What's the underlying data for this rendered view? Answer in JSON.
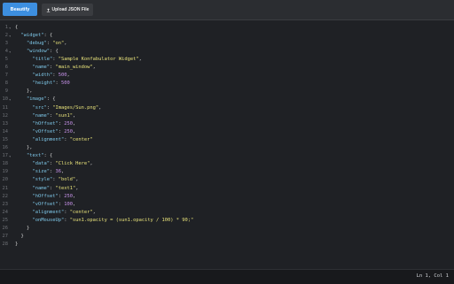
{
  "toolbar": {
    "beautify_label": "Beautify",
    "upload_label": "Upload JSON File",
    "upload_icon": "upload-icon"
  },
  "status": {
    "cursor": "Ln 1, Col 1"
  },
  "colors": {
    "accent": "#3d8fe0",
    "key": "#7ec7e8",
    "string": "#e8e27a",
    "number": "#c792ea",
    "background": "#1f2125"
  },
  "editor": {
    "lines": [
      {
        "n": "1",
        "fold": true,
        "t": [
          [
            "p",
            "{"
          ]
        ]
      },
      {
        "n": "2",
        "fold": true,
        "t": [
          [
            "p",
            "  "
          ],
          [
            "k",
            "\"widget\""
          ],
          [
            "p",
            ": {"
          ]
        ]
      },
      {
        "n": "3",
        "fold": false,
        "t": [
          [
            "p",
            "    "
          ],
          [
            "k",
            "\"debug\""
          ],
          [
            "p",
            ": "
          ],
          [
            "s",
            "\"on\""
          ],
          [
            "p",
            ","
          ]
        ]
      },
      {
        "n": "4",
        "fold": true,
        "t": [
          [
            "p",
            "    "
          ],
          [
            "k",
            "\"window\""
          ],
          [
            "p",
            ": {"
          ]
        ]
      },
      {
        "n": "5",
        "fold": false,
        "t": [
          [
            "p",
            "      "
          ],
          [
            "k",
            "\"title\""
          ],
          [
            "p",
            ": "
          ],
          [
            "s",
            "\"Sample Konfabulator Widget\""
          ],
          [
            "p",
            ","
          ]
        ]
      },
      {
        "n": "6",
        "fold": false,
        "t": [
          [
            "p",
            "      "
          ],
          [
            "k",
            "\"name\""
          ],
          [
            "p",
            ": "
          ],
          [
            "s",
            "\"main_window\""
          ],
          [
            "p",
            ","
          ]
        ]
      },
      {
        "n": "7",
        "fold": false,
        "t": [
          [
            "p",
            "      "
          ],
          [
            "k",
            "\"width\""
          ],
          [
            "p",
            ": "
          ],
          [
            "n",
            "500"
          ],
          [
            "p",
            ","
          ]
        ]
      },
      {
        "n": "8",
        "fold": false,
        "t": [
          [
            "p",
            "      "
          ],
          [
            "k",
            "\"height\""
          ],
          [
            "p",
            ": "
          ],
          [
            "n",
            "500"
          ]
        ]
      },
      {
        "n": "9",
        "fold": false,
        "t": [
          [
            "p",
            "    },"
          ]
        ]
      },
      {
        "n": "10",
        "fold": true,
        "t": [
          [
            "p",
            "    "
          ],
          [
            "k",
            "\"image\""
          ],
          [
            "p",
            ": {"
          ]
        ]
      },
      {
        "n": "11",
        "fold": false,
        "t": [
          [
            "p",
            "      "
          ],
          [
            "k",
            "\"src\""
          ],
          [
            "p",
            ": "
          ],
          [
            "s",
            "\"Images/Sun.png\""
          ],
          [
            "p",
            ","
          ]
        ]
      },
      {
        "n": "12",
        "fold": false,
        "t": [
          [
            "p",
            "      "
          ],
          [
            "k",
            "\"name\""
          ],
          [
            "p",
            ": "
          ],
          [
            "s",
            "\"sun1\""
          ],
          [
            "p",
            ","
          ]
        ]
      },
      {
        "n": "13",
        "fold": false,
        "t": [
          [
            "p",
            "      "
          ],
          [
            "k",
            "\"hOffset\""
          ],
          [
            "p",
            ": "
          ],
          [
            "n",
            "250"
          ],
          [
            "p",
            ","
          ]
        ]
      },
      {
        "n": "14",
        "fold": false,
        "t": [
          [
            "p",
            "      "
          ],
          [
            "k",
            "\"vOffset\""
          ],
          [
            "p",
            ": "
          ],
          [
            "n",
            "250"
          ],
          [
            "p",
            ","
          ]
        ]
      },
      {
        "n": "15",
        "fold": false,
        "t": [
          [
            "p",
            "      "
          ],
          [
            "k",
            "\"alignment\""
          ],
          [
            "p",
            ": "
          ],
          [
            "s",
            "\"center\""
          ]
        ]
      },
      {
        "n": "16",
        "fold": false,
        "t": [
          [
            "p",
            "    },"
          ]
        ]
      },
      {
        "n": "17",
        "fold": true,
        "t": [
          [
            "p",
            "    "
          ],
          [
            "k",
            "\"text\""
          ],
          [
            "p",
            ": {"
          ]
        ]
      },
      {
        "n": "18",
        "fold": false,
        "t": [
          [
            "p",
            "      "
          ],
          [
            "k",
            "\"data\""
          ],
          [
            "p",
            ": "
          ],
          [
            "s",
            "\"Click Here\""
          ],
          [
            "p",
            ","
          ]
        ]
      },
      {
        "n": "19",
        "fold": false,
        "t": [
          [
            "p",
            "      "
          ],
          [
            "k",
            "\"size\""
          ],
          [
            "p",
            ": "
          ],
          [
            "n",
            "36"
          ],
          [
            "p",
            ","
          ]
        ]
      },
      {
        "n": "20",
        "fold": false,
        "t": [
          [
            "p",
            "      "
          ],
          [
            "k",
            "\"style\""
          ],
          [
            "p",
            ": "
          ],
          [
            "s",
            "\"bold\""
          ],
          [
            "p",
            ","
          ]
        ]
      },
      {
        "n": "21",
        "fold": false,
        "t": [
          [
            "p",
            "      "
          ],
          [
            "k",
            "\"name\""
          ],
          [
            "p",
            ": "
          ],
          [
            "s",
            "\"text1\""
          ],
          [
            "p",
            ","
          ]
        ]
      },
      {
        "n": "22",
        "fold": false,
        "t": [
          [
            "p",
            "      "
          ],
          [
            "k",
            "\"hOffset\""
          ],
          [
            "p",
            ": "
          ],
          [
            "n",
            "250"
          ],
          [
            "p",
            ","
          ]
        ]
      },
      {
        "n": "23",
        "fold": false,
        "t": [
          [
            "p",
            "      "
          ],
          [
            "k",
            "\"vOffset\""
          ],
          [
            "p",
            ": "
          ],
          [
            "n",
            "100"
          ],
          [
            "p",
            ","
          ]
        ]
      },
      {
        "n": "24",
        "fold": false,
        "t": [
          [
            "p",
            "      "
          ],
          [
            "k",
            "\"alignment\""
          ],
          [
            "p",
            ": "
          ],
          [
            "s",
            "\"center\""
          ],
          [
            "p",
            ","
          ]
        ]
      },
      {
        "n": "25",
        "fold": false,
        "t": [
          [
            "p",
            "      "
          ],
          [
            "k",
            "\"onMouseUp\""
          ],
          [
            "p",
            ": "
          ],
          [
            "s",
            "\"sun1.opacity = (sun1.opacity / 100) * 90;\""
          ]
        ]
      },
      {
        "n": "26",
        "fold": false,
        "t": [
          [
            "p",
            "    }"
          ]
        ]
      },
      {
        "n": "27",
        "fold": false,
        "t": [
          [
            "p",
            "  }"
          ]
        ]
      },
      {
        "n": "28",
        "fold": false,
        "t": [
          [
            "p",
            "}"
          ]
        ]
      }
    ]
  }
}
